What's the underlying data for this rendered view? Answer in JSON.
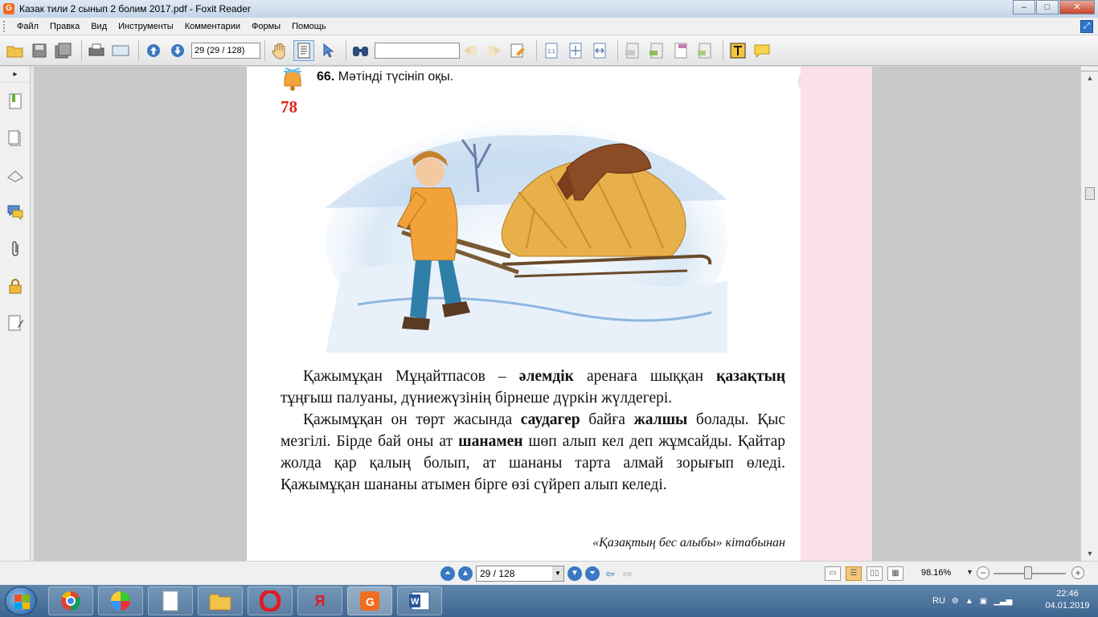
{
  "window": {
    "title": "Казак тили 2  сынып 2 болим 2017.pdf - Foxit Reader",
    "app_icon": "G",
    "min_label": "–",
    "max_label": "□",
    "close_label": "✕"
  },
  "menu": {
    "items": [
      "Файл",
      "Правка",
      "Вид",
      "Инструменты",
      "Комментарии",
      "Формы",
      "Помощь"
    ]
  },
  "toolbar": {
    "page_field": "29 (29 / 128)",
    "search_value": "",
    "icons": [
      "open-icon",
      "save-icon",
      "save-all-icon",
      "print-icon",
      "scan-icon",
      "prev-page-icon",
      "next-page-icon",
      "hand-tool-icon",
      "select-text-icon",
      "select-pointer-icon",
      "find-icon",
      "search-prev-icon",
      "search-next-icon",
      "highlight-icon",
      "zoom-actual-icon",
      "fit-page-icon",
      "fit-width-icon",
      "create-pdf-icon",
      "convert-pdf-icon",
      "pdf-file-icon",
      "pdf-export-icon",
      "typewriter-icon",
      "comment-note-icon"
    ]
  },
  "sidebar": {
    "toggle": "▸",
    "icons": [
      "bookmarks-icon",
      "pages-icon",
      "layers-icon",
      "comments-icon",
      "attachments-icon",
      "security-icon",
      "signatures-icon"
    ]
  },
  "document": {
    "page_number": "78",
    "task_number": "66.",
    "task_text": "Мәтінді түсініп оқы.",
    "paragraphs": [
      {
        "parts": [
          {
            "t": "Қажымұқан Мұңайтпасов – ",
            "b": false
          },
          {
            "t": "әлемдік",
            "b": true
          },
          {
            "t": " аренаға шыққан ",
            "b": false
          },
          {
            "t": "қазақтың",
            "b": true
          },
          {
            "t": " тұңғыш палуаны, дүниежүзінің бірнеше дүркін жүлдегері.",
            "b": false
          }
        ]
      },
      {
        "parts": [
          {
            "t": "Қажымұқан он төрт жасында ",
            "b": false
          },
          {
            "t": "саудагер",
            "b": true
          },
          {
            "t": " байға ",
            "b": false
          },
          {
            "t": "жалшы",
            "b": true
          },
          {
            "t": " болады. Қыс мезгілі. Бірде бай оны ат ",
            "b": false
          },
          {
            "t": "шанамен",
            "b": true
          },
          {
            "t": " шөп алып кел деп жұмсайды. Қайтар жолда қар қалың болып, ат шананы тарта алмай зорығып өледі. Қажымұқан шананы атымен бірге өзі сүйреп алып келеді.",
            "b": false
          }
        ]
      }
    ],
    "source": "«Қазақтың бес алыбы» кітабынан",
    "colors": {
      "page_number": "#e2231a",
      "margin_band": "#fbe0ea",
      "book_icon": "#1e5fa8"
    }
  },
  "statusbar": {
    "page_field": "29 / 128",
    "zoom": "98.16%",
    "zoom_level": 0.55
  },
  "taskbar": {
    "apps": [
      {
        "name": "chrome",
        "label": "⬤"
      },
      {
        "name": "beach-ball",
        "label": "◉"
      },
      {
        "name": "blank-doc",
        "label": "▯"
      },
      {
        "name": "file-explorer",
        "label": "▤"
      },
      {
        "name": "opera",
        "label": "O"
      },
      {
        "name": "yandex",
        "label": "Я"
      },
      {
        "name": "foxit",
        "label": "G"
      },
      {
        "name": "word",
        "label": "W"
      }
    ],
    "language": "RU",
    "time": "22:46",
    "date": "04.01.2019"
  }
}
